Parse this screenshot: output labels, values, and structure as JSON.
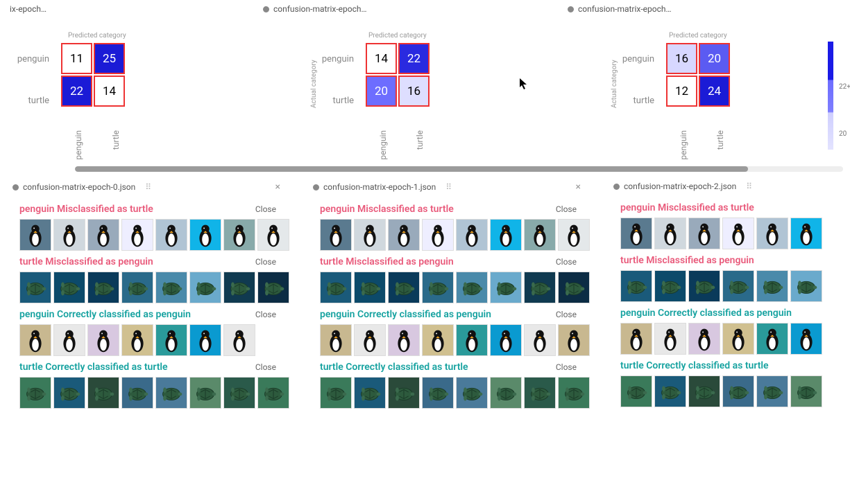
{
  "chart_data": [
    {
      "type": "heatmap",
      "title": "Predicted category",
      "rows": [
        "penguin",
        "turtle"
      ],
      "cols": [
        "penguin",
        "turtle"
      ],
      "values": [
        [
          11,
          25
        ],
        [
          22,
          14
        ]
      ]
    },
    {
      "type": "heatmap",
      "title": "Predicted category",
      "rows": [
        "penguin",
        "turtle"
      ],
      "cols": [
        "penguin",
        "turtle"
      ],
      "values": [
        [
          14,
          22
        ],
        [
          20,
          16
        ]
      ]
    },
    {
      "type": "heatmap",
      "title": "Predicted category",
      "rows": [
        "penguin",
        "turtle"
      ],
      "cols": [
        "penguin",
        "turtle"
      ],
      "values": [
        [
          16,
          20
        ],
        [
          12,
          24
        ]
      ]
    }
  ],
  "top_tabs": [
    "ix-epoch…",
    "confusion-matrix-epoch…",
    "confusion-matrix-epoch…"
  ],
  "axis_left_label": "Actual category",
  "legend": {
    "ticks": [
      "22+",
      "20"
    ]
  },
  "bottom_tabs": [
    "confusion-matrix-epoch-0.json",
    "confusion-matrix-epoch-1.json",
    "confusion-matrix-epoch-2.json"
  ],
  "tab_close": "×",
  "close_label": "Close",
  "group_titles": {
    "mis_pt": "penguin Misclassified as turtle",
    "mis_tp": "turtle Misclassified as penguin",
    "cor_pp": "penguin Correctly classified as penguin",
    "cor_tt": "turtle Correctly classified as turtle"
  },
  "cell_colors": [
    [
      [
        "#ffffff",
        "#000"
      ],
      [
        "#1b1bd6",
        "#fff"
      ],
      [
        "#1b1bd6",
        "#fff"
      ],
      [
        "#ffffff",
        "#000"
      ]
    ],
    [
      [
        "#ffffff",
        "#000"
      ],
      [
        "#2a2ae0",
        "#fff"
      ],
      [
        "#6d6dff",
        "#fff"
      ],
      [
        "#dedeff",
        "#000"
      ]
    ],
    [
      [
        "#d7d7ff",
        "#000"
      ],
      [
        "#5b5bf2",
        "#fff"
      ],
      [
        "#ffffff",
        "#000"
      ],
      [
        "#1b1bd6",
        "#fff"
      ]
    ]
  ],
  "thumb_sets": {
    "penguin_bg": [
      "#5a7a8f",
      "#d0d8de",
      "#9ab",
      "#eef",
      "#b0c4d4",
      "#10b4e8",
      "#8aa",
      "#e4e8ea"
    ],
    "turtle_bg": [
      "#1a5a7a",
      "#0c4a6a",
      "#0a3a5a",
      "#2a6a8a",
      "#4a8aaa",
      "#6aaaCC",
      "#103a50",
      "#0c2c44"
    ],
    "penguin2_bg": [
      "#c8b890",
      "#e8e8e8",
      "#d8c8e0",
      "#d0c090",
      "#2a9a9a",
      "#0a9ad0",
      "#e8e8e8"
    ],
    "turtle2_bg": [
      "#3a7a5a",
      "#1a5a7a",
      "#2a4a3a",
      "#3a6a8a",
      "#4a7a9a",
      "#5a8a6a",
      "#2a5a4a"
    ]
  }
}
